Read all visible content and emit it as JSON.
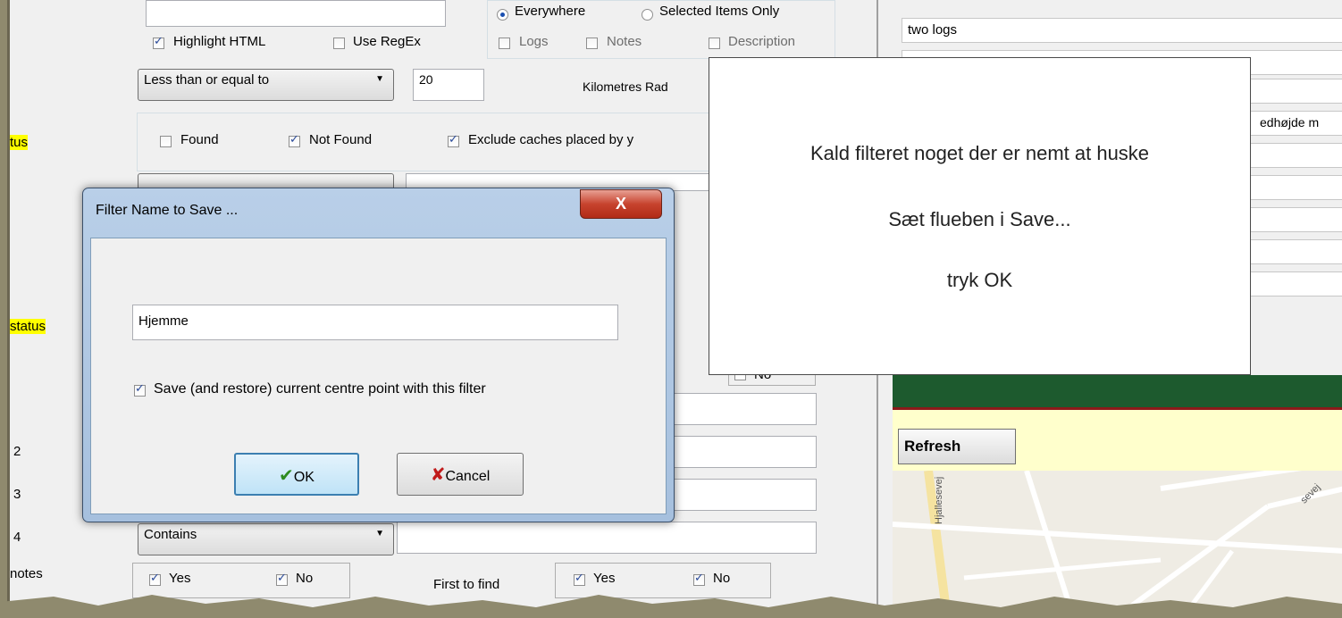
{
  "background_panel": {
    "highlight_html": "Highlight HTML",
    "use_regex": "Use RegEx",
    "everywhere": "Everywhere",
    "selected_items_only": "Selected Items Only",
    "logs": "Logs",
    "notes": "Notes",
    "description": "Description",
    "distance_op": "Less than or equal to",
    "distance_value": "20",
    "distance_unit": "Kilometres Rad",
    "found": "Found",
    "not_found": "Not Found",
    "exclude_caches": "Exclude caches placed by y",
    "contains": "Contains",
    "yes": "Yes",
    "no": "No",
    "no_partial": "No",
    "first_to_find": "First to find",
    "side_labels": {
      "status1": "tus",
      "status2": "status",
      "num2": "2",
      "num3": "3",
      "num4": "4",
      "notes": "notes"
    }
  },
  "right_panel": {
    "row1": "two logs",
    "row_partial": "edhøjde m",
    "refresh": "Refresh",
    "map_street_1": "Hjallesevej",
    "map_street_2": "sevej"
  },
  "callout": {
    "line1": "Kald filteret noget der er nemt at huske",
    "line2": "Sæt flueben i Save...",
    "line3": "tryk OK"
  },
  "dialog": {
    "title": "Filter Name to Save ...",
    "close_glyph": "X",
    "name_value": "Hjemme",
    "save_centre": "Save (and restore) current centre point with this filter",
    "ok": "OK",
    "cancel": "Cancel"
  },
  "colors": {
    "highlight": "#ffff00",
    "map_banner": "#1d5a2e",
    "refresh_bar": "#ffffcc"
  }
}
